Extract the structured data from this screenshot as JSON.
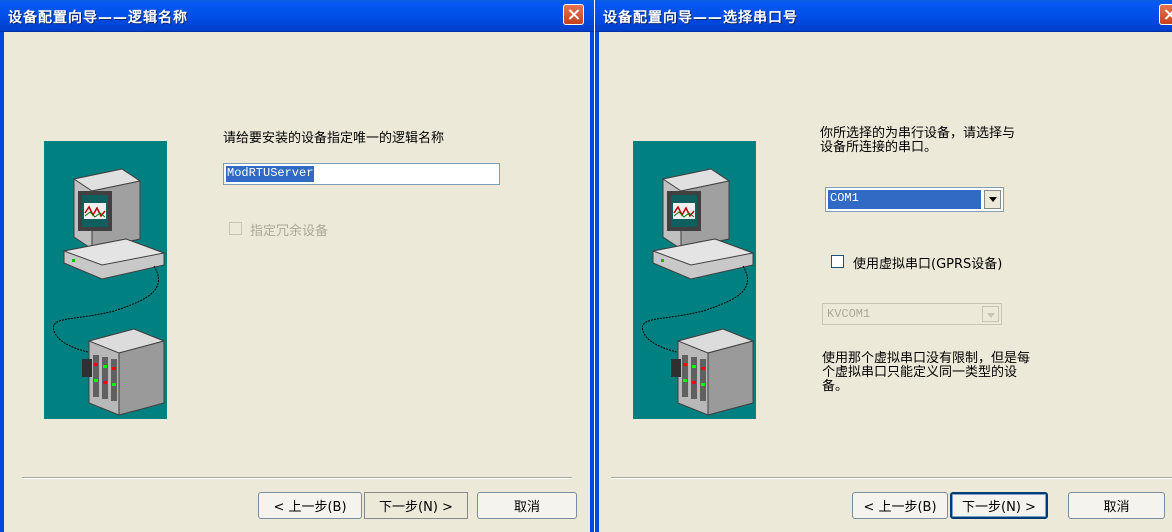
{
  "dialog_left": {
    "title": "设备配置向导——逻辑名称",
    "prompt": "请给要安装的设备指定唯一的逻辑名称",
    "logical_name_value": "ModRTUServer",
    "redundant_checkbox_label": "指定冗余设备",
    "buttons": {
      "back": "< 上一步(B)",
      "next": "下一步(N) >",
      "cancel": "取消"
    }
  },
  "dialog_right": {
    "title": "设备配置向导——选择串口号",
    "prompt_line1": "你所选择的为串行设备，请选择与",
    "prompt_line2": "设备所连接的串口。",
    "port_select_value": "COM1",
    "virtual_port_checkbox_label": "使用虚拟串口(GPRS设备)",
    "virtual_port_select_value": "KVCOM1",
    "note_line1": "使用那个虚拟串口没有限制，但是每",
    "note_line2": "个虚拟串口只能定义同一类型的设",
    "note_line3": "备。",
    "buttons": {
      "back": "< 上一步(B)",
      "next": "下一步(N) >",
      "cancel": "取消"
    }
  },
  "colors": {
    "titlebar": "#0049df",
    "dialog_bg": "#ece9d8",
    "picture_bg": "#008080",
    "selection": "#316ac5"
  }
}
